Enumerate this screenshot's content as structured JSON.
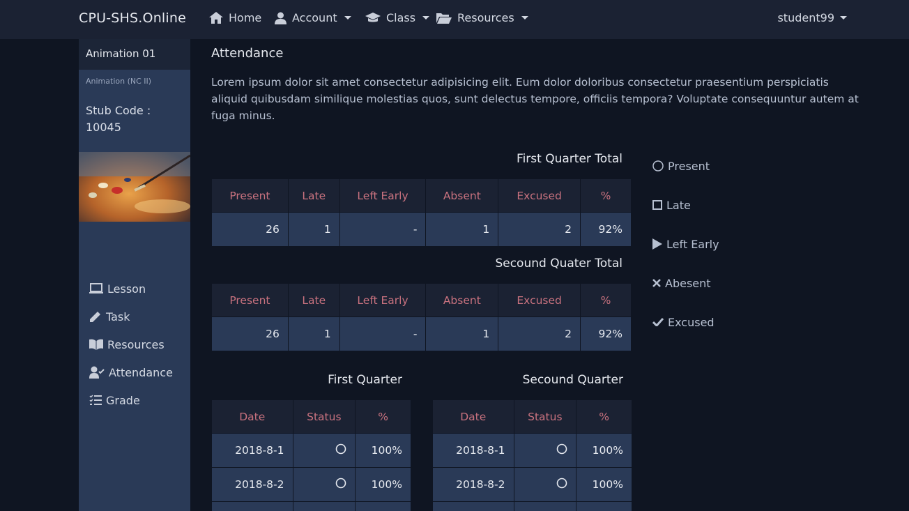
{
  "nav": {
    "brand": "CPU-SHS.Online",
    "home": "Home",
    "account": "Account",
    "class": "Class",
    "resources": "Resources",
    "user": "student99"
  },
  "sidebar": {
    "course_title": "Animation 01",
    "course_sub": "Animation (NC II)",
    "stub_code": "Stub Code : 10045",
    "menu": [
      "Lesson",
      "Task",
      "Resources",
      "Attendance",
      "Grade"
    ]
  },
  "main": {
    "title": "Attendance",
    "intro": "Lorem ipsum dolor sit amet consectetur adipisicing elit. Eum dolor doloribus consectetur praesentium perspiciatis aliquid quibusdam similique molestias quos, sunt delectus tempore, officiis tempora? Voluptate consequuntur autem at fuga minus."
  },
  "totals": {
    "headers": [
      "Present",
      "Late",
      "Left Early",
      "Absent",
      "Excused",
      "%"
    ],
    "first_title": "First Quarter Total",
    "first_row": [
      "26",
      "1",
      "-",
      "1",
      "2",
      "92%"
    ],
    "second_title": "Secound Quater Total",
    "second_row": [
      "26",
      "1",
      "-",
      "1",
      "2",
      "92%"
    ]
  },
  "quarters": {
    "headers": [
      "Date",
      "Status",
      "%"
    ],
    "first_title": "First Quarter",
    "second_title": "Secound Quarter",
    "first_rows": [
      {
        "date": "2018-8-1",
        "status": "present",
        "pct": "100%"
      },
      {
        "date": "2018-8-2",
        "status": "present",
        "pct": "100%"
      }
    ],
    "second_rows": [
      {
        "date": "2018-8-1",
        "status": "present",
        "pct": "100%"
      },
      {
        "date": "2018-8-2",
        "status": "present",
        "pct": "100%"
      }
    ]
  },
  "legend": [
    "Present",
    "Late",
    "Left Early",
    "Abesent",
    "Excused"
  ]
}
